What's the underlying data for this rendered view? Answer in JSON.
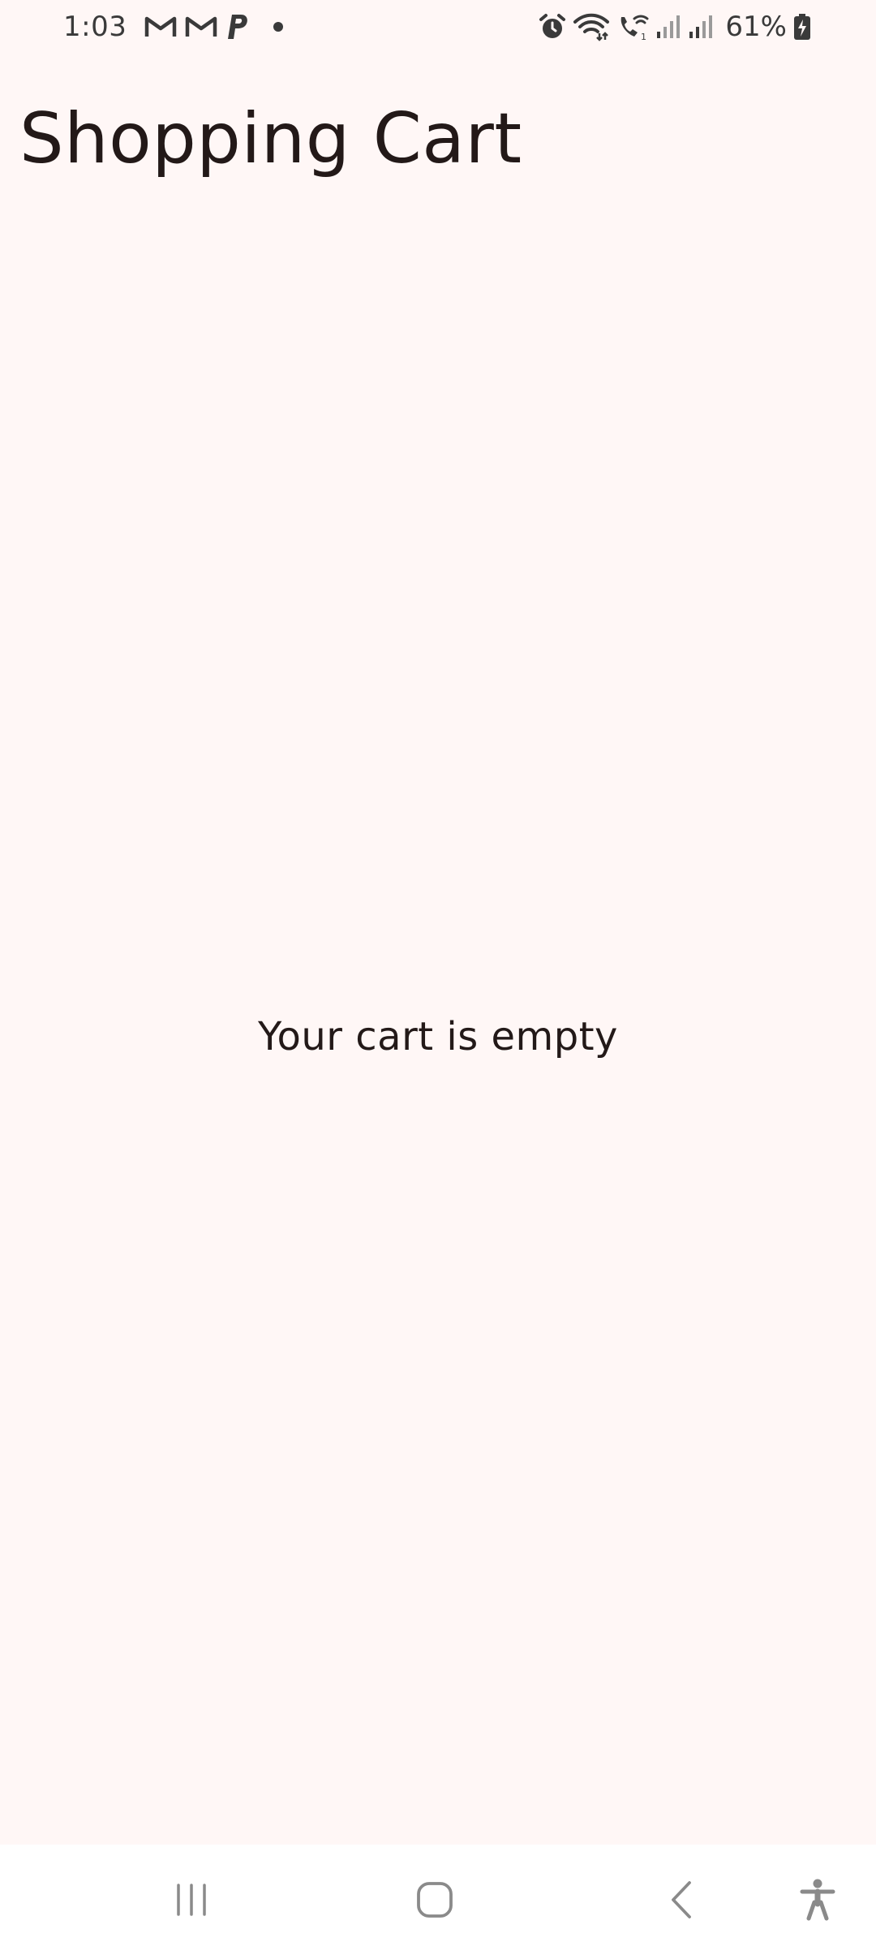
{
  "status_bar": {
    "time": "1:03",
    "battery_percent": "61%",
    "left_icons": [
      "gmail-icon",
      "gmail-icon",
      "paypal-icon",
      "notification-dot-icon"
    ],
    "right_icons": [
      "alarm-icon",
      "wifi-icon",
      "wifi-calling-icon",
      "signal-icon",
      "signal-icon",
      "battery-charging-icon"
    ]
  },
  "header": {
    "title": "Shopping Cart"
  },
  "main": {
    "empty_message": "Your cart is empty"
  },
  "nav_bar": {
    "buttons": [
      "recent-apps-icon",
      "home-icon",
      "back-icon",
      "accessibility-icon"
    ]
  },
  "colors": {
    "background": "#FFF7F6",
    "text": "#231918",
    "nav_background": "#FFFFFF",
    "nav_icon": "#8a8a8a"
  }
}
